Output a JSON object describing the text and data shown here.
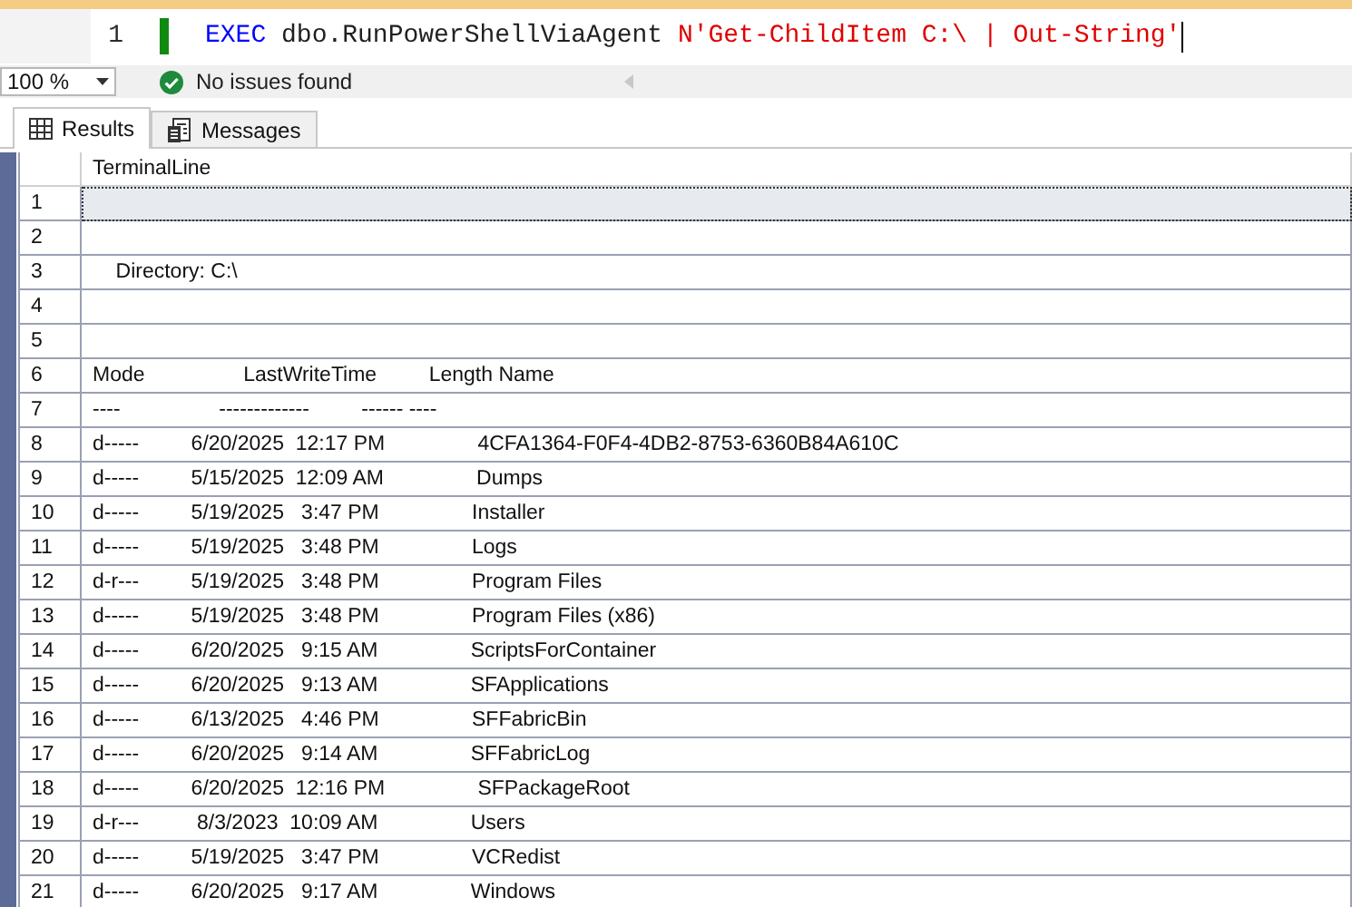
{
  "editor": {
    "line_number": "1",
    "code": [
      {
        "kind": "keyword",
        "text": "EXEC"
      },
      {
        "kind": "plain",
        "text": " dbo.RunPowerShellViaAgent "
      },
      {
        "kind": "string",
        "text": "N'Get-ChildItem C:\\ | Out-String'"
      }
    ]
  },
  "status": {
    "zoom": "100 %",
    "message": "No issues found"
  },
  "tabs": [
    {
      "label": "Results",
      "kind": "grid",
      "selected": true
    },
    {
      "label": "Messages",
      "kind": "messages",
      "selected": false
    }
  ],
  "table": {
    "columns": [
      "TerminalLine"
    ],
    "rows": [
      {
        "number": "1",
        "selected": true
      },
      {
        "number": "2",
        "selected": false
      },
      {
        "number": "3",
        "line": "    Directory: C:\\",
        "selected": false
      },
      {
        "number": "4",
        "selected": false
      },
      {
        "number": "5",
        "selected": false
      },
      {
        "number": "6",
        "line": "Mode                 LastWriteTime         Length Name",
        "selected": false
      },
      {
        "number": "7",
        "line": "----                 -------------         ------ ----",
        "selected": false
      },
      {
        "number": "8",
        "line": "d-----         6/20/2025  12:17 PM                4CFA1364-F0F4-4DB2-8753-6360B84A610C",
        "selected": false
      },
      {
        "number": "9",
        "line": "d-----         5/15/2025  12:09 AM                Dumps",
        "selected": false
      },
      {
        "number": "10",
        "line": "d-----         5/19/2025   3:47 PM                Installer",
        "selected": false
      },
      {
        "number": "11",
        "line": "d-----         5/19/2025   3:48 PM                Logs",
        "selected": false
      },
      {
        "number": "12",
        "line": "d-r---         5/19/2025   3:48 PM                Program Files",
        "selected": false
      },
      {
        "number": "13",
        "line": "d-----         5/19/2025   3:48 PM                Program Files (x86)",
        "selected": false
      },
      {
        "number": "14",
        "line": "d-----         6/20/2025   9:15 AM                ScriptsForContainer",
        "selected": false
      },
      {
        "number": "15",
        "line": "d-----         6/20/2025   9:13 AM                SFApplications",
        "selected": false
      },
      {
        "number": "16",
        "line": "d-----         6/13/2025   4:46 PM                SFFabricBin",
        "selected": false
      },
      {
        "number": "17",
        "line": "d-----         6/20/2025   9:14 AM                SFFabricLog",
        "selected": false
      },
      {
        "number": "18",
        "line": "d-----         6/20/2025  12:16 PM                SFPackageRoot",
        "selected": false
      },
      {
        "number": "19",
        "line": "d-r---          8/3/2023  10:09 AM                Users",
        "selected": false
      },
      {
        "number": "20",
        "line": "d-----         5/19/2025   3:47 PM                VCRedist",
        "selected": false
      },
      {
        "number": "21",
        "line": "d-----         6/20/2025   9:17 AM                Windows",
        "selected": false
      }
    ]
  }
}
